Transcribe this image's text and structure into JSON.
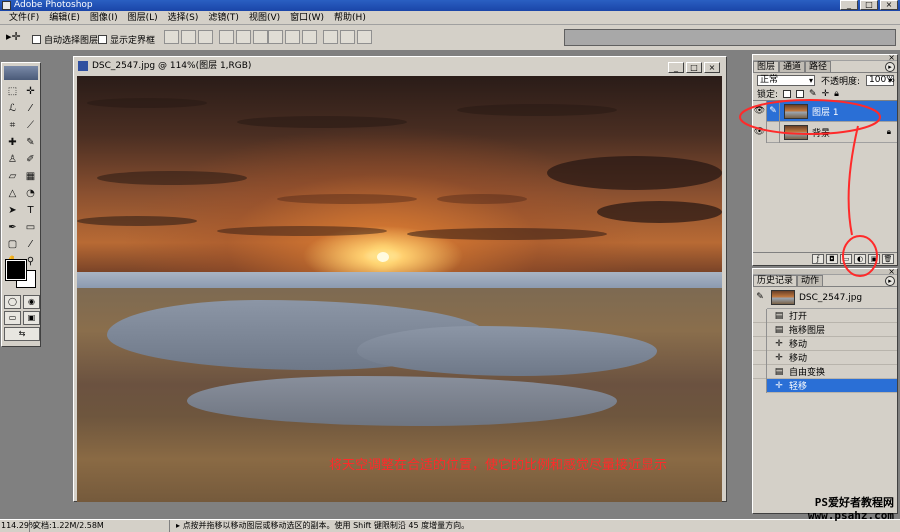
{
  "window": {
    "title": "Adobe Photoshop",
    "min_label": "_",
    "max_label": "□",
    "close_label": "×"
  },
  "menu": [
    "文件(F)",
    "编辑(E)",
    "图像(I)",
    "图层(L)",
    "选择(S)",
    "滤镜(T)",
    "视图(V)",
    "窗口(W)",
    "帮助(H)"
  ],
  "options": {
    "tool_icon": "move-icon",
    "auto_select_label": "自动选择图层",
    "show_bounds_label": "显示定界框"
  },
  "document": {
    "title": "DSC_2547.jpg @ 114%(图层 1,RGB)",
    "caption": "将天空调整在合适的位置，使它的比例和感觉尽量接近显示"
  },
  "layers_panel": {
    "tabs": [
      "图层",
      "通道",
      "路径"
    ],
    "blend_mode": "正常",
    "opacity_label": "不透明度:",
    "opacity_value": "100%",
    "lock_label": "锁定:",
    "layers": [
      {
        "name": "图层 1",
        "selected": true,
        "visible": true
      },
      {
        "name": "背景",
        "selected": false,
        "visible": true,
        "locked": true
      }
    ]
  },
  "history_panel": {
    "tabs": [
      "历史记录",
      "动作"
    ],
    "snapshot": "DSC_2547.jpg",
    "items": [
      {
        "label": "打开",
        "icon": "document-icon"
      },
      {
        "label": "拖移图层",
        "icon": "document-icon"
      },
      {
        "label": "移动",
        "icon": "move-icon"
      },
      {
        "label": "移动",
        "icon": "move-icon"
      },
      {
        "label": "自由变换",
        "icon": "document-icon"
      },
      {
        "label": "轻移",
        "icon": "move-icon",
        "selected": true
      }
    ]
  },
  "status": {
    "zoom": "114.29%",
    "doc": "文档:1.22M/2.58M",
    "hint": "点按并拖移以移动图层或移动选区的副本。使用 Shift 键限制沿 45 度增量方向。"
  },
  "watermark": {
    "line1": "PS爱好者教程网",
    "line2": "www.psahz.com"
  },
  "colors": {
    "selection": "#2a6fd6",
    "annotation": "#ff2a2a",
    "chrome": "#d4d0c8"
  }
}
